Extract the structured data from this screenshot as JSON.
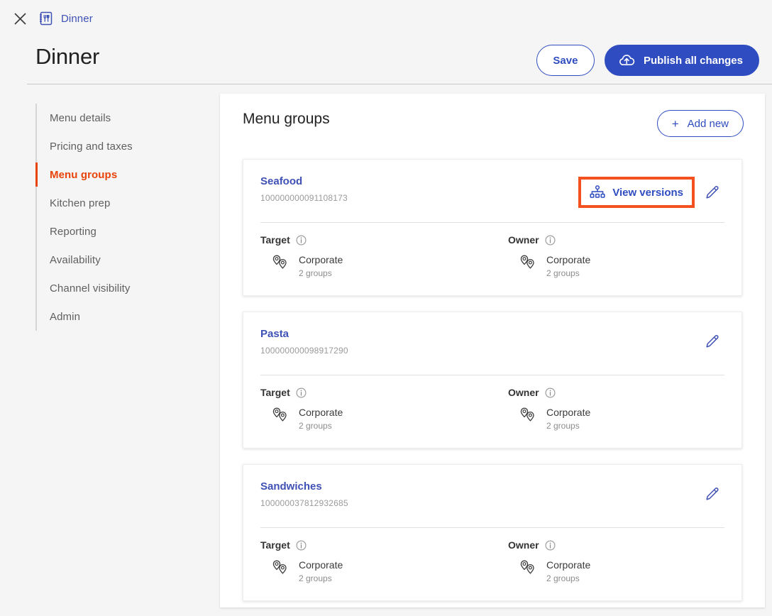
{
  "topbar": {
    "close_icon": "close-icon",
    "menu_icon": "menu-book-icon",
    "breadcrumb_label": "Dinner"
  },
  "header": {
    "title": "Dinner",
    "save_label": "Save",
    "publish_label": "Publish all changes",
    "publish_icon": "cloud-upload-icon"
  },
  "sidebar": {
    "items": [
      {
        "label": "Menu details",
        "active": false
      },
      {
        "label": "Pricing and taxes",
        "active": false
      },
      {
        "label": "Menu groups",
        "active": true
      },
      {
        "label": "Kitchen prep",
        "active": false
      },
      {
        "label": "Reporting",
        "active": false
      },
      {
        "label": "Availability",
        "active": false
      },
      {
        "label": "Channel visibility",
        "active": false
      },
      {
        "label": "Admin",
        "active": false
      }
    ]
  },
  "main": {
    "title": "Menu groups",
    "add_new_label": "Add new",
    "add_new_plus": "+",
    "view_versions_label": "View versions",
    "target_label": "Target",
    "owner_label": "Owner",
    "groups": [
      {
        "name": "Seafood",
        "id": "100000000091108173",
        "has_view_versions": true,
        "highlighted": true,
        "target": {
          "name": "Corporate",
          "count": "2 groups"
        },
        "owner": {
          "name": "Corporate",
          "count": "2 groups"
        }
      },
      {
        "name": "Pasta",
        "id": "100000000098917290",
        "has_view_versions": false,
        "highlighted": false,
        "target": {
          "name": "Corporate",
          "count": "2 groups"
        },
        "owner": {
          "name": "Corporate",
          "count": "2 groups"
        }
      },
      {
        "name": "Sandwiches",
        "id": "100000037812932685",
        "has_view_versions": false,
        "highlighted": false,
        "target": {
          "name": "Corporate",
          "count": "2 groups"
        },
        "owner": {
          "name": "Corporate",
          "count": "2 groups"
        }
      }
    ]
  },
  "colors": {
    "accent_blue": "#2f4cc0",
    "link_blue": "#3f51b5",
    "active_orange": "#e8430a",
    "highlight_orange": "#f4511e",
    "page_bg": "#f5f5f5"
  }
}
